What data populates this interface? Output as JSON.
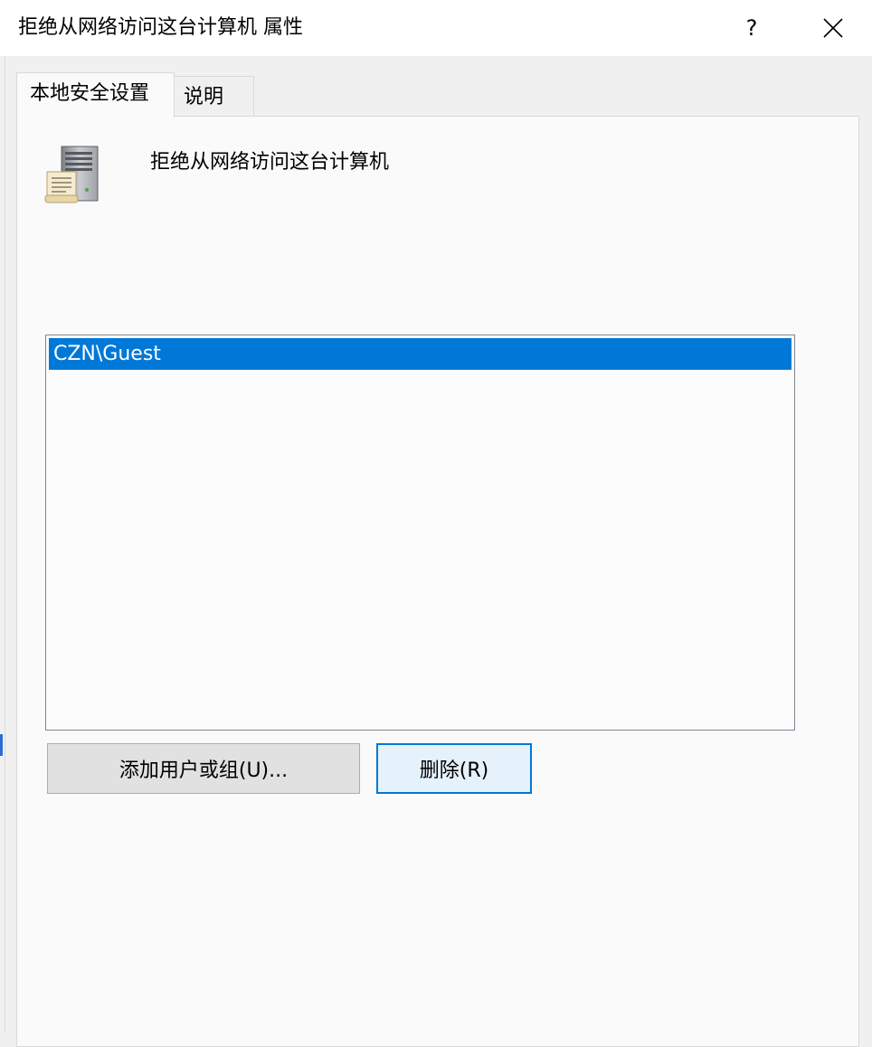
{
  "window": {
    "title": "拒绝从网络访问这台计算机 属性",
    "help_label": "?",
    "close_icon": "close-icon"
  },
  "tabs": [
    {
      "label": "本地安全设置",
      "active": true
    },
    {
      "label": "说明",
      "active": false
    }
  ],
  "policy": {
    "icon": "server-policy-icon",
    "name": "拒绝从网络访问这台计算机"
  },
  "accounts": {
    "items": [
      {
        "label": "CZN\\Guest",
        "selected": true
      }
    ]
  },
  "buttons": {
    "add_label": "添加用户或组(U)...",
    "remove_label": "删除(R)"
  },
  "colors": {
    "selection": "#0078d7",
    "focus_border": "#0078d7"
  }
}
